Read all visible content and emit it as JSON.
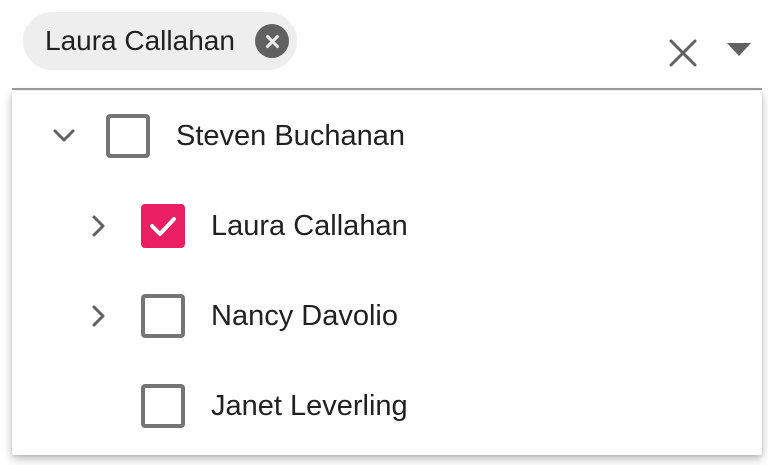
{
  "selection": {
    "chips": [
      {
        "label": "Laura Callahan"
      }
    ]
  },
  "icons": {
    "chip_remove": "close-circle-icon",
    "clear_all": "close-icon",
    "dropdown": "caret-down-icon",
    "expanded": "chevron-down-icon",
    "collapsed": "chevron-right-icon",
    "check": "check-icon"
  },
  "colors": {
    "accent": "#e91e63",
    "chip_background": "#eeeeee",
    "border": "#757575"
  },
  "tree": {
    "items": [
      {
        "label": "Steven Buchanan",
        "level": 0,
        "expanded": true,
        "has_children": true,
        "checked": false
      },
      {
        "label": "Laura Callahan",
        "level": 1,
        "expanded": false,
        "has_children": true,
        "checked": true
      },
      {
        "label": "Nancy Davolio",
        "level": 1,
        "expanded": false,
        "has_children": true,
        "checked": false
      },
      {
        "label": "Janet Leverling",
        "level": 1,
        "expanded": false,
        "has_children": false,
        "checked": false
      }
    ]
  }
}
